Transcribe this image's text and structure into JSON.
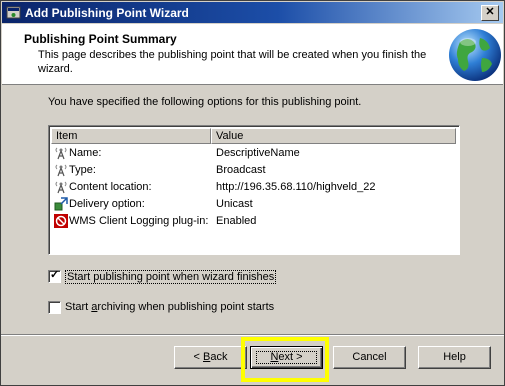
{
  "window": {
    "title": "Add Publishing Point Wizard",
    "close_glyph": "✕"
  },
  "header": {
    "title": "Publishing Point Summary",
    "description": "This page describes the publishing point that will be created when you finish the wizard."
  },
  "intro_text": "You have specified the following options for this publishing point.",
  "list": {
    "columns": [
      "Item",
      "Value"
    ],
    "rows": [
      {
        "icon": "broadcast-tower-icon",
        "item": "Name:",
        "value": "DescriptiveName"
      },
      {
        "icon": "broadcast-tower-icon",
        "item": "Type:",
        "value": "Broadcast"
      },
      {
        "icon": "broadcast-tower-icon",
        "item": "Content location:",
        "value": "http://196.35.68.110/highveld_22"
      },
      {
        "icon": "delivery-icon",
        "item": "Delivery option:",
        "value": "Unicast"
      },
      {
        "icon": "disabled-plugin-icon",
        "item": "WMS Client Logging plug-in:",
        "value": "Enabled"
      }
    ]
  },
  "options": {
    "start_publishing": {
      "label_pre": "Start publishing point when wizard finishes",
      "checked": true
    },
    "start_archiving": {
      "label_pre": "Start ",
      "label_access": "a",
      "label_post": "rchiving when publishing point starts",
      "checked": false
    }
  },
  "buttons": {
    "back": {
      "pre": "< ",
      "access": "B",
      "post": "ack"
    },
    "next": {
      "access": "N",
      "post": "ext >"
    },
    "cancel": "Cancel",
    "help": "Help"
  },
  "colors": {
    "highlight": "#ffff00",
    "title_bar_start": "#0a246a",
    "title_bar_end": "#a6caf0"
  }
}
